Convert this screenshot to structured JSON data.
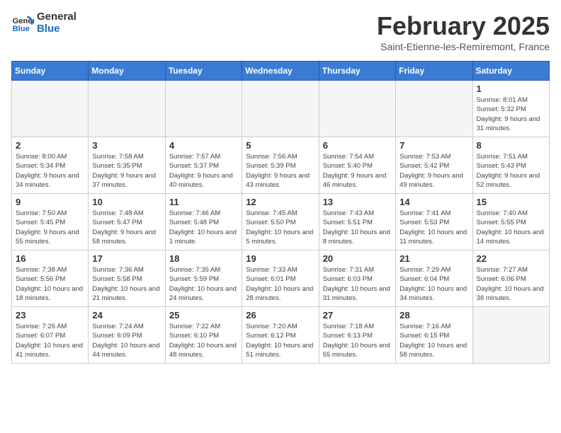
{
  "header": {
    "logo_line1": "General",
    "logo_line2": "Blue",
    "month_title": "February 2025",
    "subtitle": "Saint-Etienne-les-Remiremont, France"
  },
  "weekdays": [
    "Sunday",
    "Monday",
    "Tuesday",
    "Wednesday",
    "Thursday",
    "Friday",
    "Saturday"
  ],
  "weeks": [
    [
      {
        "day": "",
        "info": ""
      },
      {
        "day": "",
        "info": ""
      },
      {
        "day": "",
        "info": ""
      },
      {
        "day": "",
        "info": ""
      },
      {
        "day": "",
        "info": ""
      },
      {
        "day": "",
        "info": ""
      },
      {
        "day": "1",
        "info": "Sunrise: 8:01 AM\nSunset: 5:32 PM\nDaylight: 9 hours and 31 minutes."
      }
    ],
    [
      {
        "day": "2",
        "info": "Sunrise: 8:00 AM\nSunset: 5:34 PM\nDaylight: 9 hours and 34 minutes."
      },
      {
        "day": "3",
        "info": "Sunrise: 7:58 AM\nSunset: 5:35 PM\nDaylight: 9 hours and 37 minutes."
      },
      {
        "day": "4",
        "info": "Sunrise: 7:57 AM\nSunset: 5:37 PM\nDaylight: 9 hours and 40 minutes."
      },
      {
        "day": "5",
        "info": "Sunrise: 7:56 AM\nSunset: 5:39 PM\nDaylight: 9 hours and 43 minutes."
      },
      {
        "day": "6",
        "info": "Sunrise: 7:54 AM\nSunset: 5:40 PM\nDaylight: 9 hours and 46 minutes."
      },
      {
        "day": "7",
        "info": "Sunrise: 7:53 AM\nSunset: 5:42 PM\nDaylight: 9 hours and 49 minutes."
      },
      {
        "day": "8",
        "info": "Sunrise: 7:51 AM\nSunset: 5:43 PM\nDaylight: 9 hours and 52 minutes."
      }
    ],
    [
      {
        "day": "9",
        "info": "Sunrise: 7:50 AM\nSunset: 5:45 PM\nDaylight: 9 hours and 55 minutes."
      },
      {
        "day": "10",
        "info": "Sunrise: 7:48 AM\nSunset: 5:47 PM\nDaylight: 9 hours and 58 minutes."
      },
      {
        "day": "11",
        "info": "Sunrise: 7:46 AM\nSunset: 5:48 PM\nDaylight: 10 hours and 1 minute."
      },
      {
        "day": "12",
        "info": "Sunrise: 7:45 AM\nSunset: 5:50 PM\nDaylight: 10 hours and 5 minutes."
      },
      {
        "day": "13",
        "info": "Sunrise: 7:43 AM\nSunset: 5:51 PM\nDaylight: 10 hours and 8 minutes."
      },
      {
        "day": "14",
        "info": "Sunrise: 7:41 AM\nSunset: 5:53 PM\nDaylight: 10 hours and 11 minutes."
      },
      {
        "day": "15",
        "info": "Sunrise: 7:40 AM\nSunset: 5:55 PM\nDaylight: 10 hours and 14 minutes."
      }
    ],
    [
      {
        "day": "16",
        "info": "Sunrise: 7:38 AM\nSunset: 5:56 PM\nDaylight: 10 hours and 18 minutes."
      },
      {
        "day": "17",
        "info": "Sunrise: 7:36 AM\nSunset: 5:58 PM\nDaylight: 10 hours and 21 minutes."
      },
      {
        "day": "18",
        "info": "Sunrise: 7:35 AM\nSunset: 5:59 PM\nDaylight: 10 hours and 24 minutes."
      },
      {
        "day": "19",
        "info": "Sunrise: 7:33 AM\nSunset: 6:01 PM\nDaylight: 10 hours and 28 minutes."
      },
      {
        "day": "20",
        "info": "Sunrise: 7:31 AM\nSunset: 6:03 PM\nDaylight: 10 hours and 31 minutes."
      },
      {
        "day": "21",
        "info": "Sunrise: 7:29 AM\nSunset: 6:04 PM\nDaylight: 10 hours and 34 minutes."
      },
      {
        "day": "22",
        "info": "Sunrise: 7:27 AM\nSunset: 6:06 PM\nDaylight: 10 hours and 38 minutes."
      }
    ],
    [
      {
        "day": "23",
        "info": "Sunrise: 7:26 AM\nSunset: 6:07 PM\nDaylight: 10 hours and 41 minutes."
      },
      {
        "day": "24",
        "info": "Sunrise: 7:24 AM\nSunset: 6:09 PM\nDaylight: 10 hours and 44 minutes."
      },
      {
        "day": "25",
        "info": "Sunrise: 7:22 AM\nSunset: 6:10 PM\nDaylight: 10 hours and 48 minutes."
      },
      {
        "day": "26",
        "info": "Sunrise: 7:20 AM\nSunset: 6:12 PM\nDaylight: 10 hours and 51 minutes."
      },
      {
        "day": "27",
        "info": "Sunrise: 7:18 AM\nSunset: 6:13 PM\nDaylight: 10 hours and 55 minutes."
      },
      {
        "day": "28",
        "info": "Sunrise: 7:16 AM\nSunset: 6:15 PM\nDaylight: 10 hours and 58 minutes."
      },
      {
        "day": "",
        "info": ""
      }
    ]
  ]
}
